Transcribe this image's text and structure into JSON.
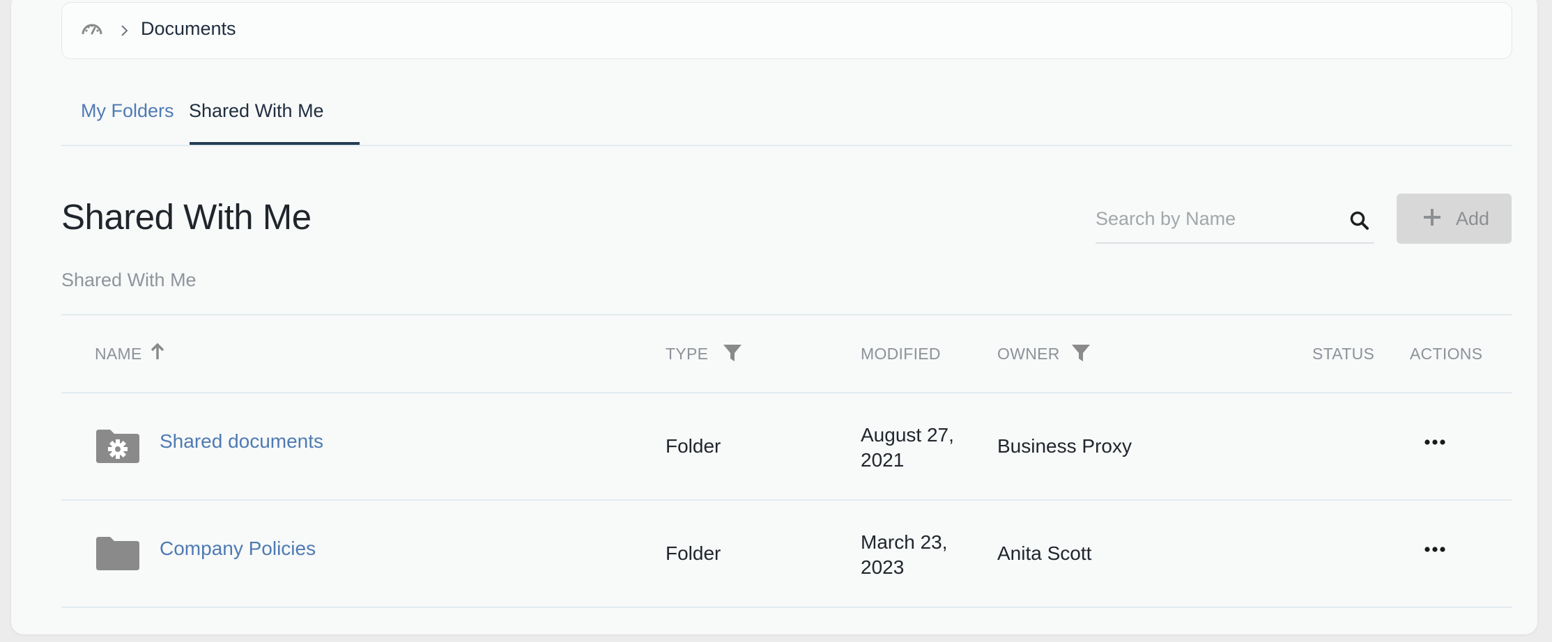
{
  "breadcrumb": {
    "home_icon": "dashboard-gauge-icon",
    "separator_icon": "chevron-right-icon",
    "current": "Documents"
  },
  "tabs": [
    {
      "label": "My Folders",
      "active": false
    },
    {
      "label": "Shared With Me",
      "active": true
    }
  ],
  "page": {
    "title": "Shared With Me",
    "subtitle": "Shared With Me"
  },
  "search": {
    "placeholder": "Search by Name",
    "value": "",
    "icon": "search-icon"
  },
  "add_button": {
    "label": "Add",
    "icon": "plus-icon",
    "disabled": true
  },
  "table": {
    "columns": {
      "name": "NAME",
      "type": "TYPE",
      "modified": "MODIFIED",
      "owner": "OWNER",
      "status": "STATUS",
      "actions": "ACTIONS"
    },
    "sort": {
      "column": "name",
      "direction": "ascending",
      "icon": "arrow-up-icon"
    },
    "rows": [
      {
        "icon": "shared-folder-gear-icon",
        "name": "Shared documents",
        "type": "Folder",
        "modified": "August 27, 2021",
        "owner": "Business Proxy",
        "status": "",
        "actions_icon": "ellipsis-icon"
      },
      {
        "icon": "folder-icon",
        "name": "Company Policies",
        "type": "Folder",
        "modified": "March 23, 2023",
        "owner": "Anita Scott",
        "status": "",
        "actions_icon": "ellipsis-icon"
      }
    ]
  },
  "colors": {
    "link": "#4e7bb3",
    "active_tab_underline": "#243b53",
    "muted_text": "#8c9298",
    "icon_gray": "#8a8a8a"
  }
}
